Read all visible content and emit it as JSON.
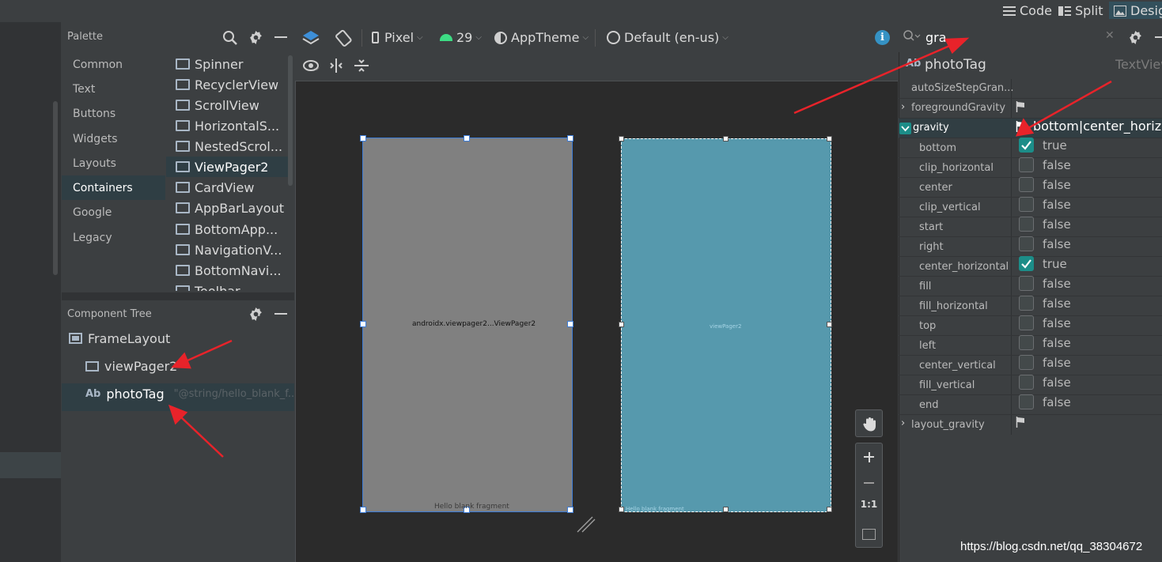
{
  "mode_bar": {
    "code_label": "Code",
    "split_label": "Split",
    "design_label": "Design"
  },
  "palette": {
    "title": "Palette",
    "categories": [
      "Common",
      "Text",
      "Buttons",
      "Widgets",
      "Layouts",
      "Containers",
      "Google",
      "Legacy"
    ],
    "selected_category": "Containers",
    "items": [
      "Spinner",
      "RecyclerView",
      "ScrollView",
      "HorizontalS...",
      "NestedScrol...",
      "ViewPager2",
      "CardView",
      "AppBarLayout",
      "BottomApp...",
      "NavigationV...",
      "BottomNavi...",
      "Toolbar"
    ],
    "selected_item": "ViewPager2"
  },
  "component_tree": {
    "title": "Component Tree",
    "nodes": [
      {
        "label": "FrameLayout",
        "icon": "frame-layout-icon",
        "hint": ""
      },
      {
        "label": "viewPager2",
        "icon": "unknown-view-icon",
        "hint": ""
      },
      {
        "label": "photoTag",
        "icon": "textview-ab-icon",
        "hint": "\"@string/hello_blank_f..."
      }
    ]
  },
  "design_toolbar": {
    "device": "Pixel",
    "api": "29",
    "theme": "AppTheme",
    "locale": "Default (en-us)"
  },
  "canvas": {
    "design_label": "androidx.viewpager2...ViewPager2",
    "design_text": "Hello blank fragment",
    "blueprint_label": "viewPager2",
    "blueprint_text": "Hello blank fragment",
    "zoom_one_to_one": "1:1"
  },
  "attributes": {
    "search_value": "gra",
    "icon_prefix": "Ab",
    "component_id": "photoTag",
    "component_type": "TextView",
    "rows": [
      {
        "name": "autoSizeStepGran...",
        "kind": "plain"
      },
      {
        "name": "foregroundGravity",
        "kind": "flag-collapsed"
      },
      {
        "name": "gravity",
        "kind": "flag-expanded",
        "value": "bottom|center_horizo"
      }
    ],
    "gravity_flags": [
      {
        "name": "bottom",
        "value": "true",
        "checked": true
      },
      {
        "name": "clip_horizontal",
        "value": "false",
        "checked": false
      },
      {
        "name": "center",
        "value": "false",
        "checked": false
      },
      {
        "name": "clip_vertical",
        "value": "false",
        "checked": false
      },
      {
        "name": "start",
        "value": "false",
        "checked": false
      },
      {
        "name": "right",
        "value": "false",
        "checked": false
      },
      {
        "name": "center_horizontal",
        "value": "true",
        "checked": true
      },
      {
        "name": "fill",
        "value": "false",
        "checked": false
      },
      {
        "name": "fill_horizontal",
        "value": "false",
        "checked": false
      },
      {
        "name": "top",
        "value": "false",
        "checked": false
      },
      {
        "name": "left",
        "value": "false",
        "checked": false
      },
      {
        "name": "center_vertical",
        "value": "false",
        "checked": false
      },
      {
        "name": "fill_vertical",
        "value": "false",
        "checked": false
      },
      {
        "name": "end",
        "value": "false",
        "checked": false
      }
    ],
    "layout_gravity": "layout_gravity"
  },
  "watermark": "https://blog.csdn.net/qq_38304672",
  "colors": {
    "accent_teal": "#1c8d88",
    "selection_blue": "#3d7cd6",
    "annotation_red": "#e8232a"
  }
}
